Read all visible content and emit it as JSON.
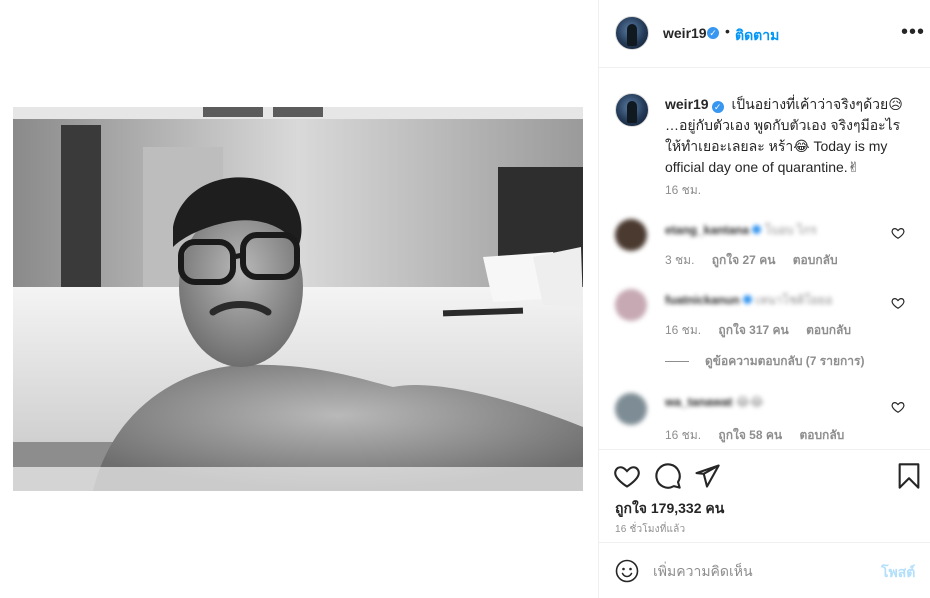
{
  "post": {
    "username": "weir19",
    "separator": "•",
    "follow_label": "ติดตาม",
    "more_label": "•••",
    "verified_mark": "✓"
  },
  "caption": {
    "username": "weir19",
    "text": "เป็นอย่างที่เค้าว่าจริงๆด้วย😥 …อยู่กับตัวเอง พูดกับตัวเอง จริงๆมีอะไรให้ทำเยอะเลยละ หร้า😂 Today is my official day one of quarantine.✌",
    "time": "16 ชม."
  },
  "comments": [
    {
      "username": "etang_kantana",
      "text": "โบอบ ไกร",
      "time": "3 ชม.",
      "likes": "ถูกใจ 27 คน",
      "reply": "ตอบกลับ",
      "avatar_color": "#4a3a30"
    },
    {
      "username": "fuatnickanun",
      "text": "เหนาโชติโยยอ",
      "time": "16 ชม.",
      "likes": "ถูกใจ 317 คน",
      "reply": "ตอบกลับ",
      "avatar_color": "#c7a9b4"
    },
    {
      "username": "wa_tanawat",
      "text": "😂😂",
      "time": "16 ชม.",
      "likes": "ถูกใจ 58 คน",
      "reply": "ตอบกลับ",
      "avatar_color": "#7e8d95"
    }
  ],
  "view_replies": "ดูข้อความตอบกลับ (7 รายการ)",
  "stats": {
    "likes": "ถูกใจ 179,332 คน",
    "time_ago": "16 ชั่วโมงที่แล้ว"
  },
  "add_comment": {
    "placeholder": "เพิ่มความคิดเห็น",
    "post_label": "โพสต์"
  },
  "colors": {
    "accent": "#0095f6",
    "verified": "#3897f0",
    "muted": "#8e8e8e",
    "post_disabled": "#b2dffc"
  }
}
